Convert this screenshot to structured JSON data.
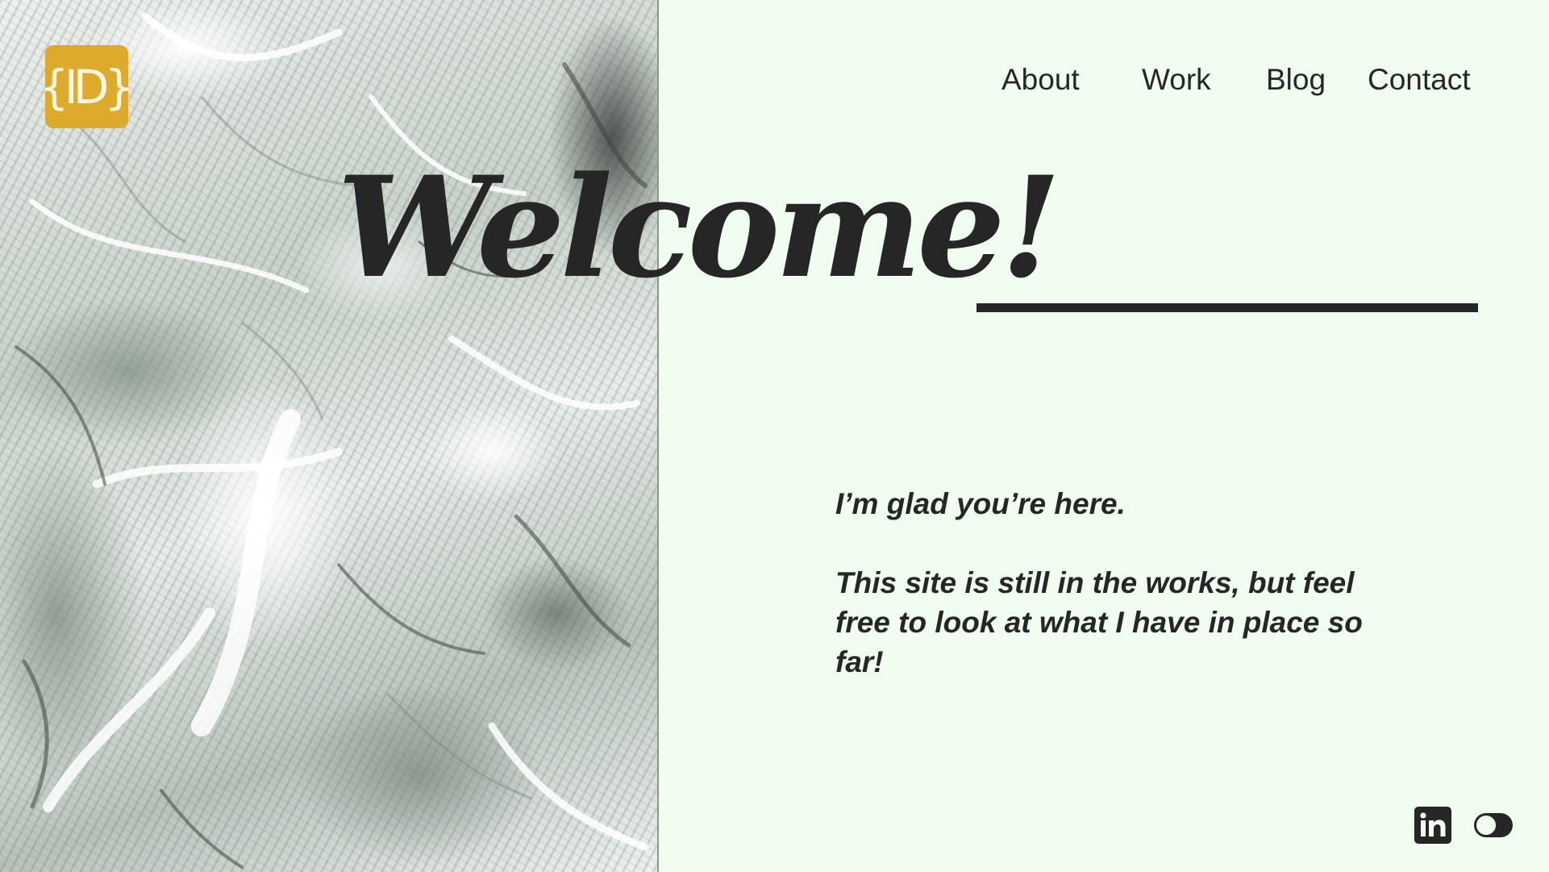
{
  "brand": {
    "logo_text": "{ID}",
    "logo_color": "#deaa2b"
  },
  "nav": {
    "items": [
      {
        "label": "About"
      },
      {
        "label": "Work"
      },
      {
        "label": "Blog"
      },
      {
        "label": "Contact"
      }
    ]
  },
  "hero": {
    "heading": "Welcome!",
    "intro_line_1": "I’m glad you’re here.",
    "intro_line_2": "This site is still in the works, but feel free to look at what I have in place so far!"
  },
  "footer": {
    "social_icon": "linkedin-icon",
    "theme_toggle_state": "off"
  },
  "colors": {
    "background": "#f2fdf1",
    "text": "#262626",
    "accent": "#deaa2b"
  }
}
